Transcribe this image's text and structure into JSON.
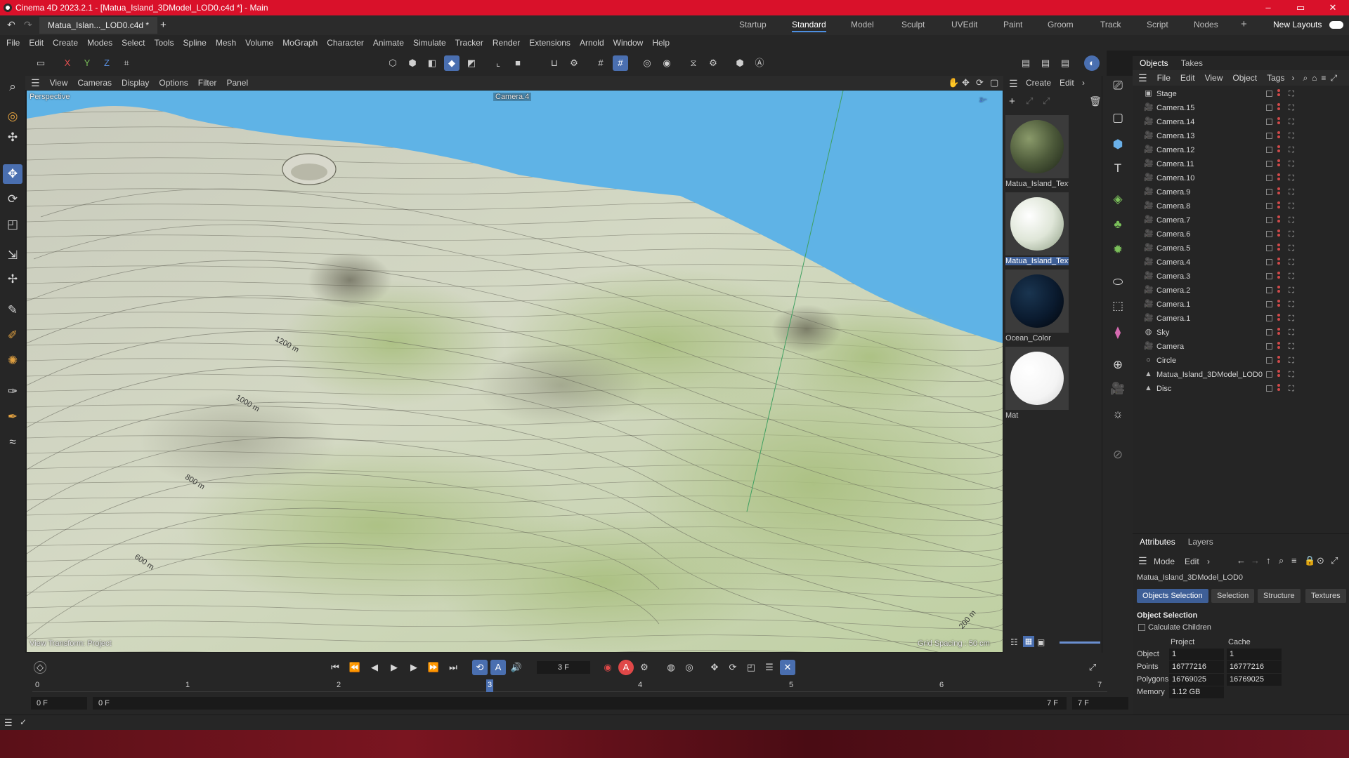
{
  "window": {
    "title": "Cinema 4D 2023.2.1 - [Matua_Island_3DModel_LOD0.c4d *] - Main",
    "controls": [
      "–",
      "▭",
      "✕"
    ]
  },
  "document_tab": {
    "label": "Matua_Islan..._LOD0.c4d *",
    "add": "+"
  },
  "layouts": {
    "items": [
      "Startup",
      "Standard",
      "Model",
      "Sculpt",
      "UVEdit",
      "Paint",
      "Groom",
      "Track",
      "Script",
      "Nodes"
    ],
    "active": "Standard",
    "new_layouts": "New Layouts",
    "add": "+"
  },
  "menu": [
    "File",
    "Edit",
    "Create",
    "Modes",
    "Select",
    "Tools",
    "Spline",
    "Mesh",
    "Volume",
    "MoGraph",
    "Character",
    "Animate",
    "Simulate",
    "Tracker",
    "Render",
    "Extensions",
    "Arnold",
    "Window",
    "Help"
  ],
  "axis_buttons": [
    "X",
    "Y",
    "Z"
  ],
  "viewport": {
    "menu": [
      "View",
      "Cameras",
      "Display",
      "Options",
      "Filter",
      "Panel"
    ],
    "view_name": "Perspective",
    "camera": "Camera.4",
    "view_transform": "View Transform: Project",
    "grid_spacing": "Grid Spacing : 50 cm",
    "contour_labels": [
      "1200 m",
      "1000 m",
      "800 m",
      "600 m",
      "200 m"
    ]
  },
  "materials": {
    "menu": [
      "Create",
      "Edit"
    ],
    "items": [
      {
        "name": "Matua_Island_Text",
        "ball": "#4d5a3a"
      },
      {
        "name": "Matua_Island_Text",
        "ball": "#dfe6d8",
        "selected": true
      },
      {
        "name": "Ocean_Color",
        "ball": "#0a1a2e"
      },
      {
        "name": "Mat",
        "ball": "#ffffff"
      }
    ]
  },
  "objects": {
    "tabs": [
      "Objects",
      "Takes"
    ],
    "active_tab": "Objects",
    "menu": [
      "File",
      "Edit",
      "View",
      "Object",
      "Tags"
    ],
    "rows": [
      {
        "name": "Stage",
        "icon": "▣"
      },
      {
        "name": "Camera.15",
        "icon": "🎥"
      },
      {
        "name": "Camera.14",
        "icon": "🎥"
      },
      {
        "name": "Camera.13",
        "icon": "🎥"
      },
      {
        "name": "Camera.12",
        "icon": "🎥"
      },
      {
        "name": "Camera.11",
        "icon": "🎥"
      },
      {
        "name": "Camera.10",
        "icon": "🎥"
      },
      {
        "name": "Camera.9",
        "icon": "🎥"
      },
      {
        "name": "Camera.8",
        "icon": "🎥"
      },
      {
        "name": "Camera.7",
        "icon": "🎥"
      },
      {
        "name": "Camera.6",
        "icon": "🎥"
      },
      {
        "name": "Camera.5",
        "icon": "🎥"
      },
      {
        "name": "Camera.4",
        "icon": "🎥"
      },
      {
        "name": "Camera.3",
        "icon": "🎥"
      },
      {
        "name": "Camera.2",
        "icon": "🎥"
      },
      {
        "name": "Camera.1",
        "icon": "🎥"
      },
      {
        "name": "Camera.1",
        "icon": "🎥"
      },
      {
        "name": "Sky",
        "icon": "◍"
      },
      {
        "name": "Camera",
        "icon": "🎥"
      },
      {
        "name": "Circle",
        "icon": "○"
      },
      {
        "name": "Matua_Island_3DModel_LOD0",
        "icon": "▲"
      },
      {
        "name": "Disc",
        "icon": "▲"
      }
    ]
  },
  "attributes": {
    "tabs": [
      "Attributes",
      "Layers"
    ],
    "active_tab": "Attributes",
    "menu": [
      "Mode",
      "Edit"
    ],
    "object_name": "Matua_Island_3DModel_LOD0",
    "buttons": [
      "Objects Selection",
      "Selection",
      "Structure",
      "Textures"
    ],
    "active_button": "Objects Selection",
    "section": "Object Selection",
    "calc_children": "Calculate Children",
    "col_project": "Project",
    "col_cache": "Cache",
    "rows": [
      {
        "label": "Object",
        "project": "1",
        "cache": "1"
      },
      {
        "label": "Points",
        "project": "16777216",
        "cache": "16777216"
      },
      {
        "label": "Polygons",
        "project": "16769025",
        "cache": "16769025"
      },
      {
        "label": "Memory",
        "project": "1.12 GB",
        "cache": ""
      }
    ]
  },
  "timeline": {
    "current_frame": "3 F",
    "ruler": [
      "0",
      "1",
      "2",
      "3",
      "4",
      "5",
      "6",
      "7"
    ],
    "current_index": 3,
    "start_field": "0 F",
    "min_field": "0 F",
    "max_field": "7 F",
    "end_field": "7 F"
  }
}
